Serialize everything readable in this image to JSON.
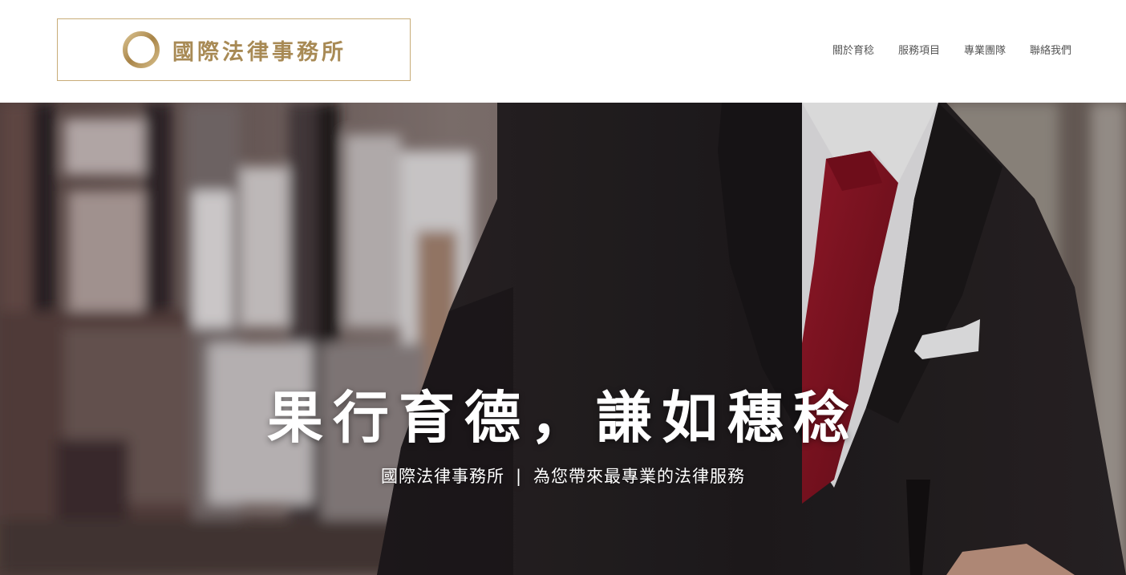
{
  "colors": {
    "gold": "#a88a55",
    "gold_border": "#c8ac78",
    "nav_text": "#555555",
    "hero_text": "#ffffff",
    "tie": "#8e1322"
  },
  "header": {
    "logo": {
      "icon": "gold-ring-icon",
      "text": "國際法律事務所"
    },
    "nav": [
      {
        "label": "關於育稔"
      },
      {
        "label": "服務項目"
      },
      {
        "label": "專業團隊"
      },
      {
        "label": "聯絡我們"
      }
    ]
  },
  "hero": {
    "headline": "果行育德，謙如穗稔",
    "subtitle": {
      "firm": "國際法律事務所",
      "separator": "|",
      "tagline": "為您帶來最專業的法律服務"
    }
  }
}
